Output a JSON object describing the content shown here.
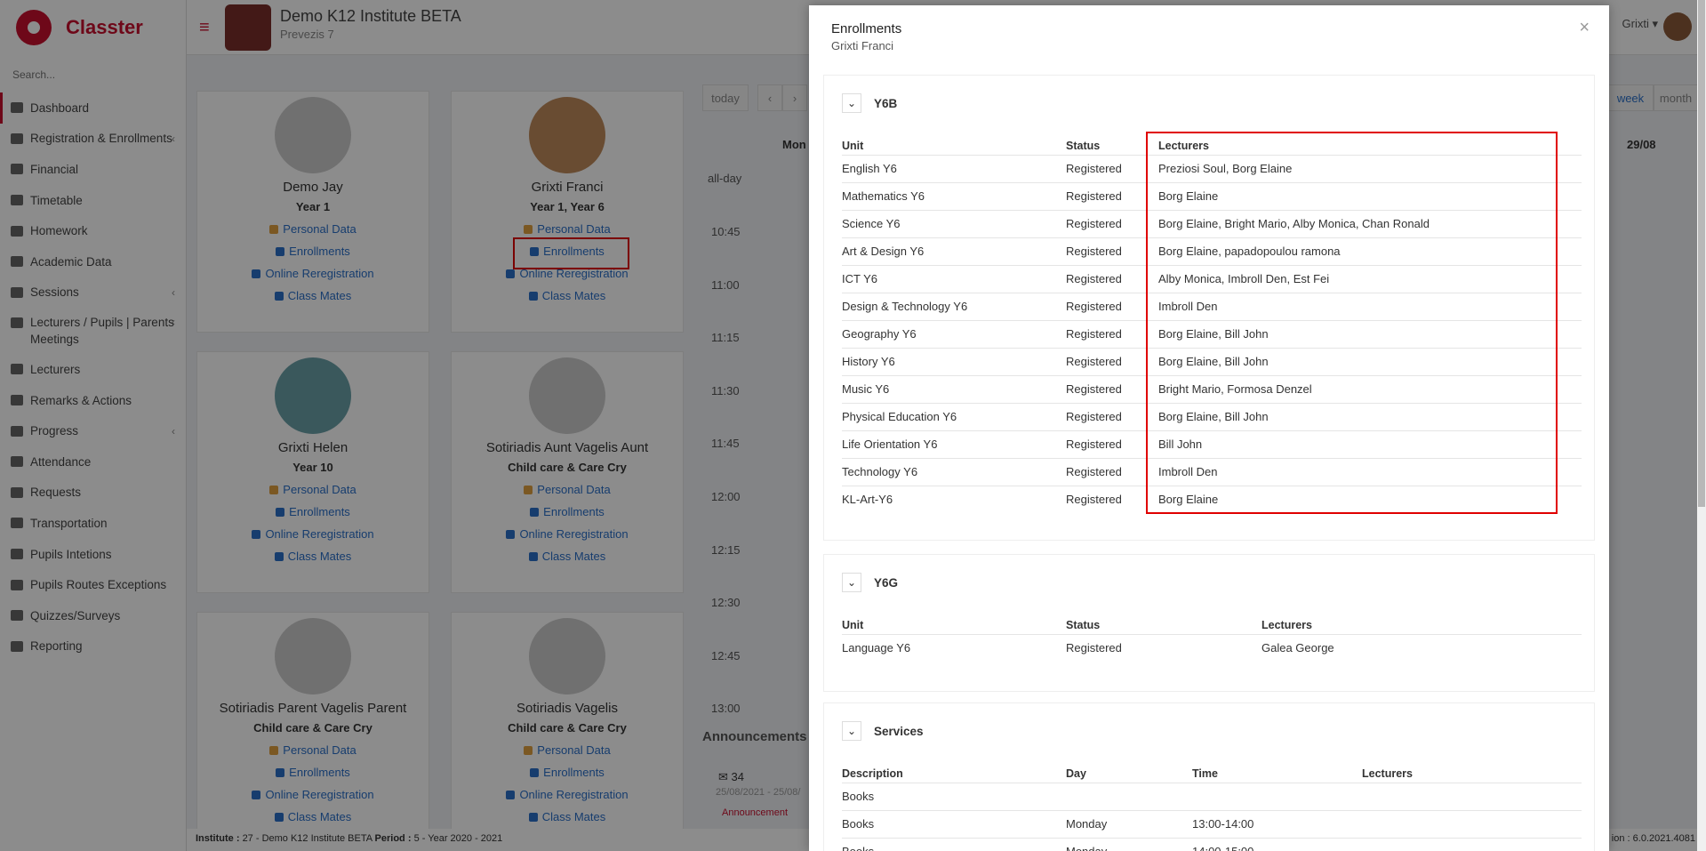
{
  "app": {
    "brand": "Classter",
    "search_placeholder": "Search..."
  },
  "sidebar": {
    "items": [
      {
        "label": "Dashboard",
        "active": true,
        "caret": false
      },
      {
        "label": "Registration & Enrollments",
        "caret": true
      },
      {
        "label": "Financial",
        "caret": false
      },
      {
        "label": "Timetable",
        "caret": false
      },
      {
        "label": "Homework",
        "caret": false
      },
      {
        "label": "Academic Data",
        "caret": false
      },
      {
        "label": "Sessions",
        "caret": true
      },
      {
        "label": "Lecturers / Pupils | Parents Meetings",
        "caret": true
      },
      {
        "label": "Lecturers",
        "caret": false
      },
      {
        "label": "Remarks & Actions",
        "caret": false
      },
      {
        "label": "Progress",
        "caret": true
      },
      {
        "label": "Attendance",
        "caret": false
      },
      {
        "label": "Requests",
        "caret": false
      },
      {
        "label": "Transportation",
        "caret": false
      },
      {
        "label": "Pupils Intetions",
        "caret": false
      },
      {
        "label": "Pupils Routes Exceptions",
        "caret": false
      },
      {
        "label": "Quizzes/Surveys",
        "caret": false
      },
      {
        "label": "Reporting",
        "caret": false
      }
    ]
  },
  "header": {
    "institute": "Demo K12 Institute BETA",
    "sub": "Prevezis 7",
    "user": "Grixti"
  },
  "cards": [
    {
      "name": "Demo Jay",
      "grade": "Year 1"
    },
    {
      "name": "Grixti Franci",
      "grade": "Year 1, Year 6"
    },
    {
      "name": "Grixti Helen",
      "grade": "Year 10"
    },
    {
      "name": "Sotiriadis Aunt Vagelis Aunt",
      "grade": "Child care & Care Cry"
    },
    {
      "name": "Sotiriadis Parent Vagelis Parent",
      "grade": "Child care & Care Cry"
    },
    {
      "name": "Sotiriadis Vagelis",
      "grade": "Child care & Care Cry"
    }
  ],
  "card_links": {
    "personal": "Personal Data",
    "enrollments": "Enrollments",
    "online": "Online Reregistration",
    "classmates": "Class Mates"
  },
  "calendar": {
    "today": "today",
    "prev": "‹",
    "next": "›",
    "week": "week",
    "month": "month",
    "mon": "Mon",
    "date": "29/08",
    "allday": "all-day",
    "times": [
      "10:45",
      "11:00",
      "11:15",
      "11:30",
      "11:45",
      "12:00",
      "12:15",
      "12:30",
      "12:45",
      "13:00"
    ]
  },
  "announcements": {
    "title": "Announcements",
    "count": "34",
    "date": "25/08/2021 - 25/08/",
    "tag": "Announcement"
  },
  "footer": {
    "institute_label": "Institute :",
    "institute_value": "27 - Demo K12 Institute BETA",
    "period_label": "Period :",
    "period_value": "5 - Year 2020 - 2021",
    "version": "ion : 6.0.2021.4081"
  },
  "modal": {
    "title": "Enrollments",
    "student": "Grixti Franci",
    "close": "×",
    "headers": {
      "unit": "Unit",
      "status": "Status",
      "lecturers": "Lecturers"
    },
    "y6b": {
      "title": "Y6B",
      "rows": [
        {
          "unit": "English Y6",
          "status": "Registered",
          "lecturers": "Preziosi Soul, Borg Elaine"
        },
        {
          "unit": "Mathematics Y6",
          "status": "Registered",
          "lecturers": "Borg Elaine"
        },
        {
          "unit": "Science Y6",
          "status": "Registered",
          "lecturers": "Borg Elaine, Bright Mario, Alby Monica, Chan Ronald"
        },
        {
          "unit": "Art & Design Y6",
          "status": "Registered",
          "lecturers": "Borg Elaine, papadopoulou ramona"
        },
        {
          "unit": "ICT Y6",
          "status": "Registered",
          "lecturers": "Alby Monica, Imbroll Den, Est Fei"
        },
        {
          "unit": "Design & Technology Y6",
          "status": "Registered",
          "lecturers": "Imbroll Den"
        },
        {
          "unit": "Geography Y6",
          "status": "Registered",
          "lecturers": "Borg Elaine, Bill John"
        },
        {
          "unit": "History Y6",
          "status": "Registered",
          "lecturers": "Borg Elaine, Bill John"
        },
        {
          "unit": "Music Y6",
          "status": "Registered",
          "lecturers": "Bright Mario, Formosa Denzel"
        },
        {
          "unit": "Physical Education Y6",
          "status": "Registered",
          "lecturers": "Borg Elaine, Bill John"
        },
        {
          "unit": "Life Orientation Y6",
          "status": "Registered",
          "lecturers": "Bill John"
        },
        {
          "unit": "Technology Y6",
          "status": "Registered",
          "lecturers": "Imbroll Den"
        },
        {
          "unit": "KL-Art-Y6",
          "status": "Registered",
          "lecturers": "Borg Elaine"
        }
      ]
    },
    "y6g": {
      "title": "Y6G",
      "rows": [
        {
          "unit": "Language Y6",
          "status": "Registered",
          "lecturers": "Galea George"
        }
      ]
    },
    "services": {
      "title": "Services",
      "headers": {
        "description": "Description",
        "day": "Day",
        "time": "Time",
        "lecturers": "Lecturers"
      },
      "rows": [
        {
          "description": "Books",
          "day": "",
          "time": "",
          "lecturers": ""
        },
        {
          "description": "Books",
          "day": "Monday",
          "time": "13:00-14:00",
          "lecturers": ""
        },
        {
          "description": "Books",
          "day": "Monday",
          "time": "14:00-15:00",
          "lecturers": ""
        }
      ]
    }
  },
  "colors": {
    "brand": "#c8102e",
    "link": "#2a6fc9",
    "highlight": "#e00000"
  }
}
